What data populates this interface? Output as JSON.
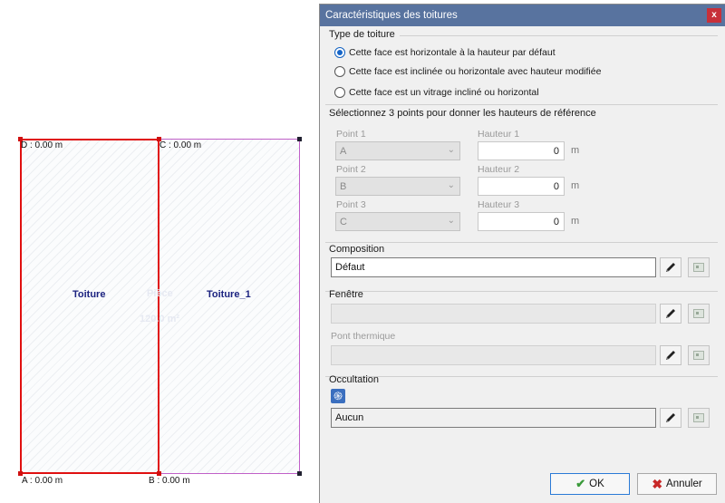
{
  "plan": {
    "corners": {
      "d": "D : 0.00 m",
      "c": "C : 0.00 m",
      "a": "A : 0.00 m",
      "b": "B : 0.00 m"
    },
    "rooms": {
      "left": "Toiture",
      "right": "Toiture_1",
      "ghost_name": "Pièce",
      "ghost_area": "120.0 m²"
    }
  },
  "dialog": {
    "title": "Caractéristiques des toitures",
    "close_label": "x",
    "roof_type": {
      "header": "Type de toiture",
      "options": [
        {
          "label": "Cette face est horizontale à la hauteur par défaut",
          "checked": true
        },
        {
          "label": "Cette face est inclinée ou horizontale avec hauteur modifiée",
          "checked": false
        },
        {
          "label": "Cette face est un vitrage incliné ou horizontal",
          "checked": false
        }
      ]
    },
    "reference": {
      "header": "Sélectionnez 3 points pour donner les hauteurs de référence",
      "points": [
        {
          "point_label": "Point 1",
          "point_value": "A",
          "height_label": "Hauteur 1",
          "height_value": "0",
          "unit": "m"
        },
        {
          "point_label": "Point 2",
          "point_value": "B",
          "height_label": "Hauteur 2",
          "height_value": "0",
          "unit": "m"
        },
        {
          "point_label": "Point 3",
          "point_value": "C",
          "height_label": "Hauteur 3",
          "height_value": "0",
          "unit": "m"
        }
      ]
    },
    "composition": {
      "header": "Composition",
      "value": "Défaut"
    },
    "fenetre": {
      "header": "Fenêtre",
      "value": "",
      "pont_label": "Pont thermique",
      "pont_value": ""
    },
    "occultation": {
      "header": "Occultation",
      "value": "Aucun",
      "icon_glyph": "֍"
    },
    "buttons": {
      "ok": "OK",
      "cancel": "Annuler"
    }
  },
  "icons": {
    "pen": "pen-icon",
    "image": "image-icon",
    "check": "check-icon",
    "cancel": "cross-icon",
    "chevron": "chevron-down-icon"
  }
}
